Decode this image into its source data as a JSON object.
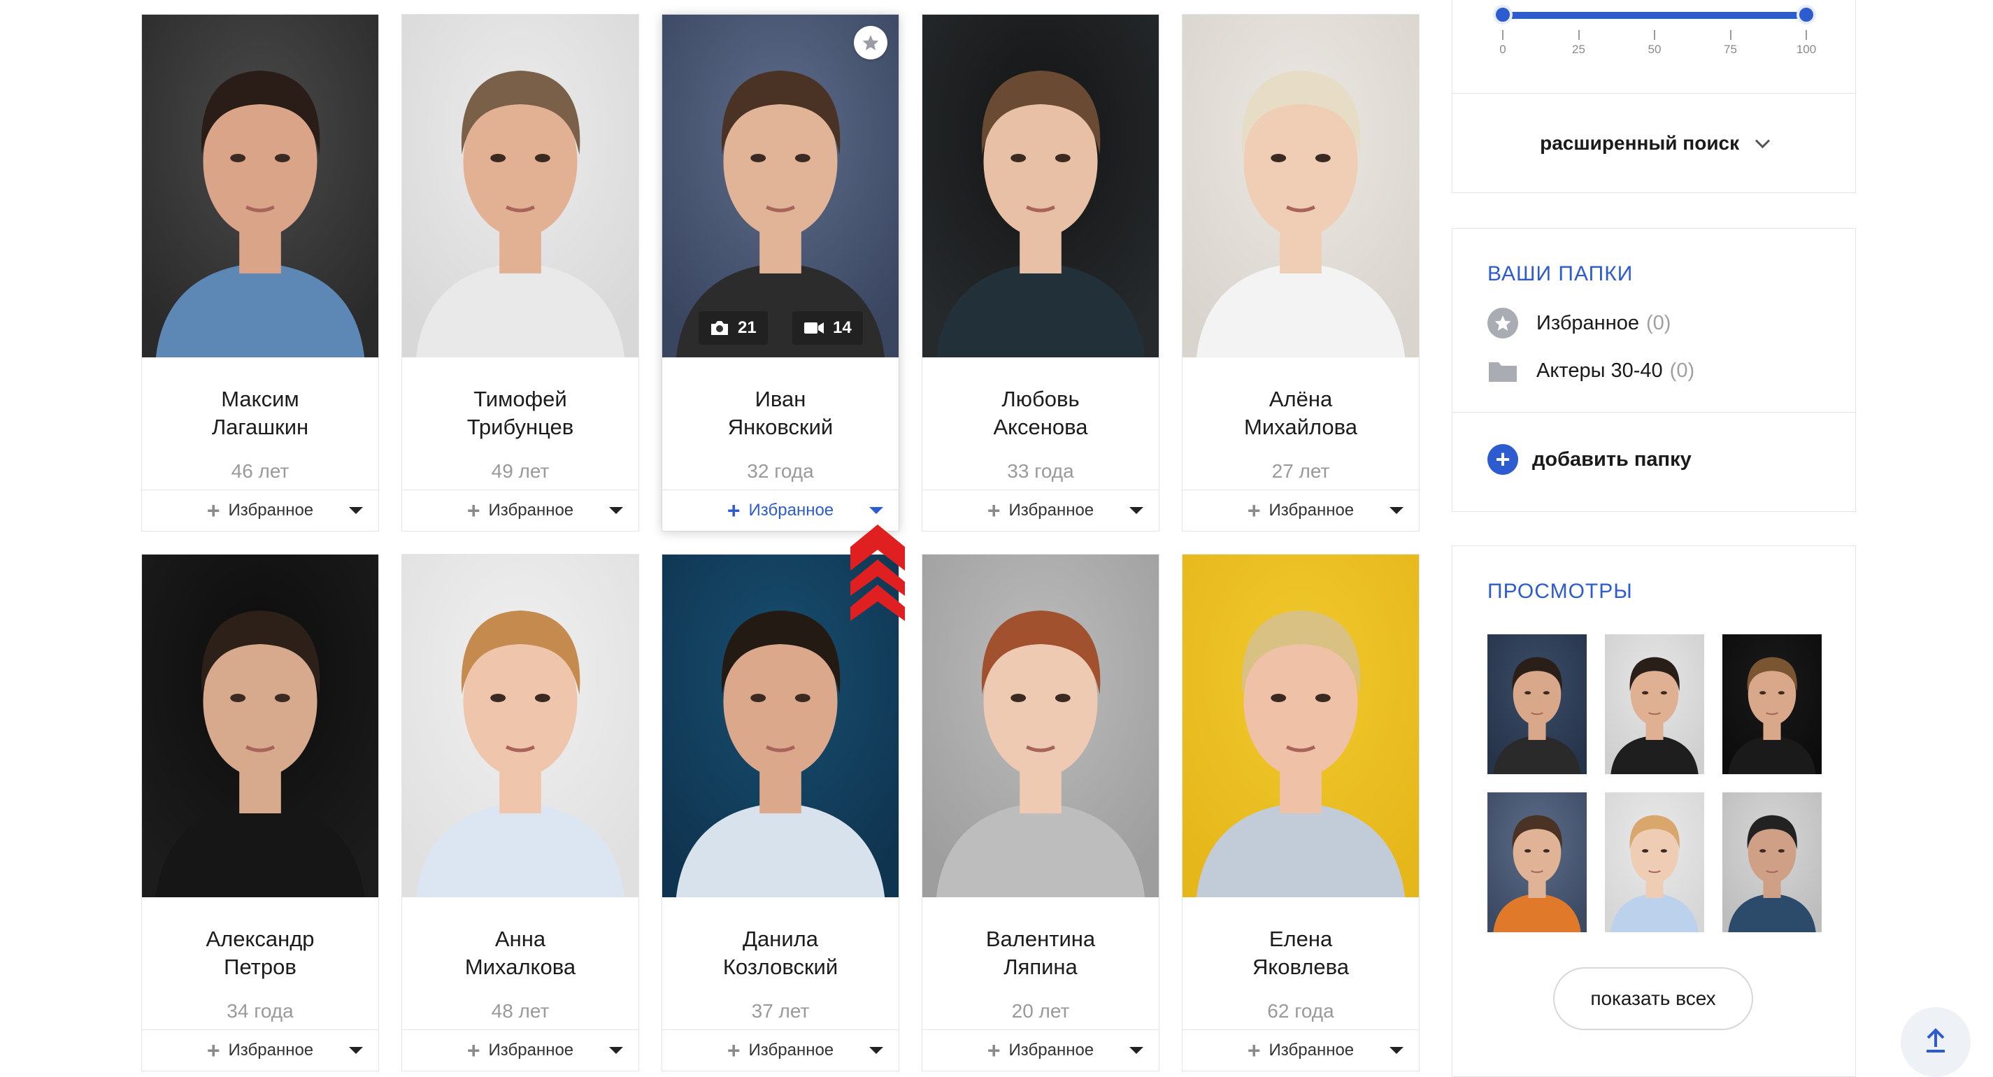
{
  "colors": {
    "accent": "#2d5bd0",
    "muted": "#9a9a9a",
    "arrow": "#e02020"
  },
  "slider": {
    "ticks": [
      "0",
      "25",
      "50",
      "75",
      "100"
    ]
  },
  "advanced_search": {
    "label": "расширенный поиск"
  },
  "actors": [
    {
      "first": "Максим",
      "last": "Лагашкин",
      "age": "46 лет",
      "fav": "Избранное"
    },
    {
      "first": "Тимофей",
      "last": "Трибунцев",
      "age": "49 лет",
      "fav": "Избранное"
    },
    {
      "first": "Иван",
      "last": "Янковский",
      "age": "32 года",
      "fav": "Избранное",
      "photos": "21",
      "videos": "14"
    },
    {
      "first": "Любовь",
      "last": "Аксенова",
      "age": "33 года",
      "fav": "Избранное"
    },
    {
      "first": "Алёна",
      "last": "Михайлова",
      "age": "27 лет",
      "fav": "Избранное"
    },
    {
      "first": "Александр",
      "last": "Петров",
      "age": "34 года",
      "fav": "Избранное"
    },
    {
      "first": "Анна",
      "last": "Михалкова",
      "age": "48 лет",
      "fav": "Избранное"
    },
    {
      "first": "Данила",
      "last": "Козловский",
      "age": "37 лет",
      "fav": "Избранное"
    },
    {
      "first": "Валентина",
      "last": "Ляпина",
      "age": "20 лет",
      "fav": "Избранное"
    },
    {
      "first": "Елена",
      "last": "Яковлева",
      "age": "62 года",
      "fav": "Избранное"
    }
  ],
  "folders": {
    "title": "ВАШИ ПАПКИ",
    "items": [
      {
        "label": "Избранное",
        "count": "(0)",
        "icon": "star-circle-icon"
      },
      {
        "label": "Актеры 30-40",
        "count": "(0)",
        "icon": "folder-icon"
      }
    ],
    "add_label": "добавить папку"
  },
  "views": {
    "title": "ПРОСМОТРЫ",
    "show_all": "показать всех"
  }
}
